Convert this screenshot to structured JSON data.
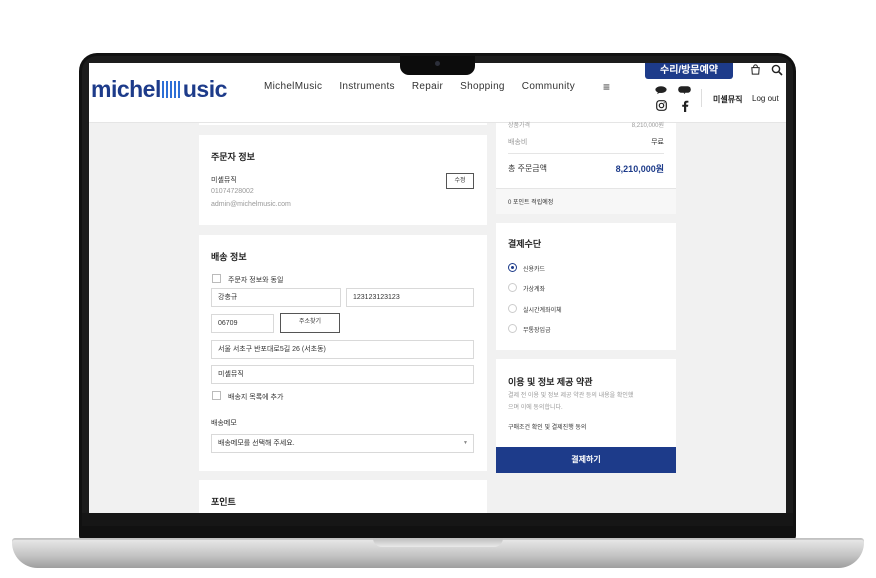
{
  "header": {
    "logo_text_left": "michel",
    "logo_text_right": "usic",
    "logo_icon": "equalizer-bars-icon",
    "nav": [
      "MichelMusic",
      "Instruments",
      "Repair",
      "Shopping",
      "Community"
    ],
    "menu_icon": "≡",
    "cta_label": "수리/방문예약",
    "user_name": "미셸뮤직",
    "logout_label": "Log out"
  },
  "summary": {
    "cut_label": "상품가격",
    "cut_value": "8,210,000원",
    "shipping_label": "배송비",
    "shipping_value": "무료",
    "total_label": "총 주문금액",
    "total_value": "8,210,000원",
    "points_note": "0 포인트 적립예정"
  },
  "orderer": {
    "title": "주문자 정보",
    "name": "미셸뮤직",
    "phone": "01074728002",
    "email": "admin@michelmusic.com",
    "edit_label": "수정"
  },
  "shipping": {
    "title": "배송 정보",
    "same_as_orderer": "주문자 정보와 동일",
    "recipient": "강충규",
    "phone": "123123123123",
    "zipcode": "06709",
    "search_address_label": "주소찾기",
    "address": "서울 서초구 반포대로5길 26 (서초동)",
    "address_detail": "미셸뮤직",
    "add_to_list": "배송지 목록에 추가",
    "memo_label": "배송메모",
    "memo_select": "배송메모를 선택해 주세요.",
    "memo_arrow": "▼"
  },
  "payment": {
    "title": "결제수단",
    "methods": [
      "신용카드",
      "가상계좌",
      "실시간계좌이체",
      "무통장입금"
    ]
  },
  "terms": {
    "title": "이용 및 정보 제공 약관",
    "description_line1": "결제 전 이용 및 정보 제공 약관 등의 내용을 확인했",
    "description_line2": "으며 이에 동의합니다.",
    "agreement": "구매조건 확인 및 결제진행 동의",
    "pay_button": "결제하기"
  },
  "points": {
    "title": "포인트"
  },
  "colors": {
    "brand": "#1d3b8a",
    "accent_bars": "#2d6fd6",
    "background": "#f1f1f1"
  }
}
